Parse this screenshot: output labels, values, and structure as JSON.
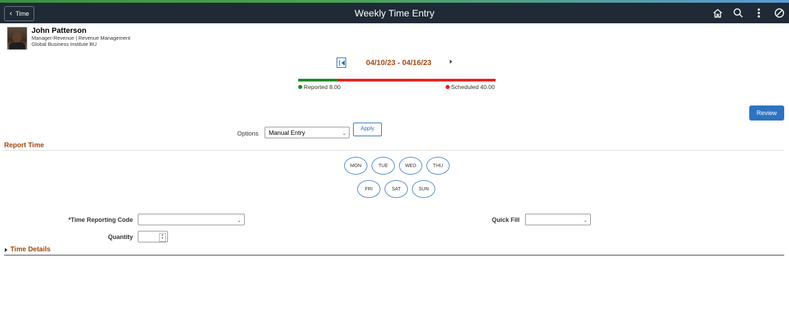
{
  "header": {
    "back_label": "Time",
    "title": "Weekly Time Entry",
    "icons": [
      "home-icon",
      "search-icon",
      "more-menu-icon",
      "navbar-icon"
    ]
  },
  "employee": {
    "name": "John Patterson",
    "title_line": "Manager-Revenue | Revenue Management",
    "org_line": "Global Business Institute BU"
  },
  "period": {
    "date_range": "04/10/23 - 04/16/23",
    "reported_label": "Reported 8.00",
    "scheduled_label": "Scheduled 40.00",
    "reported_hours": 8.0,
    "scheduled_hours": 40.0,
    "reported_color": "#1f8a2b",
    "scheduled_color": "#e8231f"
  },
  "actions": {
    "review_label": "Review",
    "apply_label": "Apply"
  },
  "options": {
    "label": "Options",
    "selected": "Manual Entry"
  },
  "report_time": {
    "title": "Report Time",
    "days_row1": [
      "MON",
      "TUE",
      "WED",
      "THU"
    ],
    "days_row2": [
      "FRI",
      "SAT",
      "SUN"
    ]
  },
  "fields": {
    "trc_label": "*Time Reporting Code",
    "trc_value": "",
    "quick_fill_label": "Quick Fill",
    "quick_fill_value": "",
    "quantity_label": "Quantity",
    "quantity_value": ""
  },
  "time_details": {
    "title": "Time Details"
  },
  "colors": {
    "accent_text": "#a0470e",
    "primary_button": "#2e73c2",
    "banner": "#1f2a36"
  }
}
